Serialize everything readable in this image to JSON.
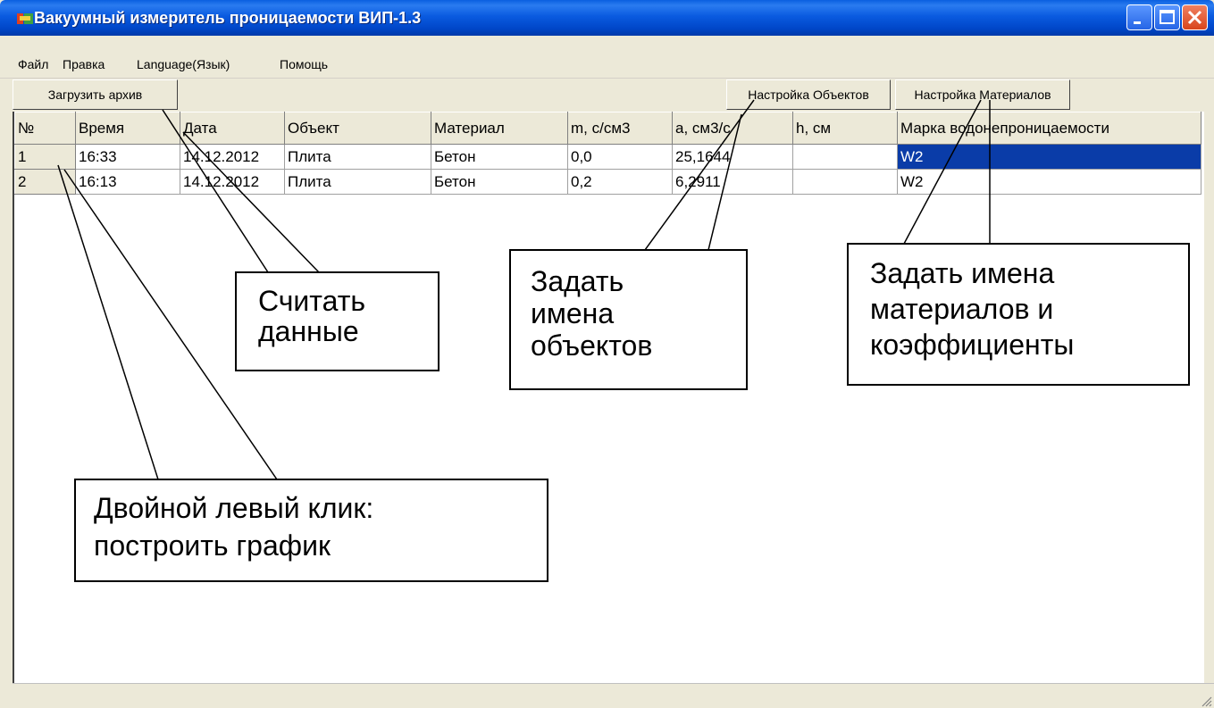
{
  "window": {
    "title": "Вакуумный измеритель проницаемости ВИП-1.3"
  },
  "menu": [
    "Файл",
    "Правка",
    "Language(Язык)",
    "Помощь"
  ],
  "toolbar": {
    "load_archive": "Загрузить архив",
    "objects_settings": "Настройка Объектов",
    "materials_settings": "Настройка Материалов"
  },
  "table": {
    "headers": [
      "№",
      "Время",
      "Дата",
      "Объект",
      "Материал",
      "m, с/см3",
      "a, см3/с",
      "h, см",
      "Марка водонепроницаемости"
    ],
    "rows": [
      [
        "1",
        "16:33",
        "14.12.2012",
        "Плита",
        "Бетон",
        "0,0",
        "25,1644",
        "",
        "W2"
      ],
      [
        "2",
        "16:13",
        "14.12.2012",
        "Плита",
        "Бетон",
        "0,2",
        "6,2911",
        "",
        "W2"
      ]
    ],
    "selected_row": 0
  },
  "callouts": {
    "read_data": [
      "Считать",
      "данные"
    ],
    "object_names": [
      "Задать",
      "имена",
      "объектов"
    ],
    "material_names": [
      "Задать имена",
      "материалов и",
      "коэффициенты"
    ],
    "double_click": [
      "Двойной левый клик:",
      "построить график"
    ]
  },
  "colors": {
    "selection": "#0a3ca8",
    "titlebar": "#0a5be0"
  },
  "icons": {
    "app": "app-icon",
    "minimize": "minimize-icon",
    "maximize": "maximize-icon",
    "close": "close-icon"
  }
}
